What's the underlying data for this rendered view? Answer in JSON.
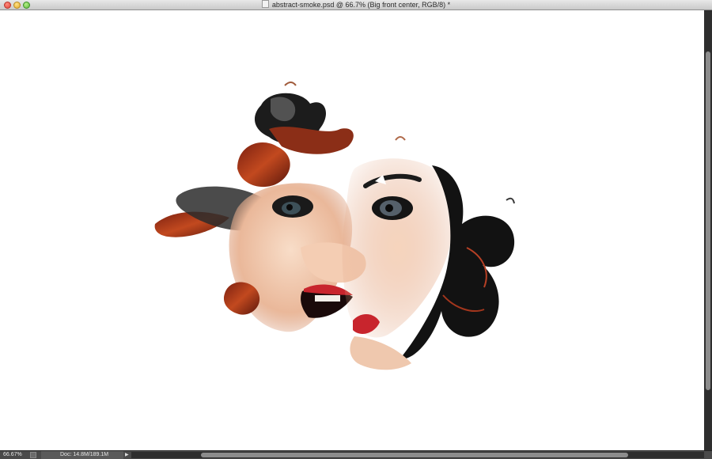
{
  "window": {
    "title": "abstract-smoke.psd @ 66.7% (Big front center, RGB/8) *"
  },
  "status": {
    "zoom": "66.67%",
    "doc_size": "Doc: 14.8M/189.1M"
  },
  "colors": {
    "canvas": "#ffffff",
    "chrome_dark": "#3a3a3a",
    "lipstick": "#c8252d",
    "hair_red": "#a3361d"
  }
}
